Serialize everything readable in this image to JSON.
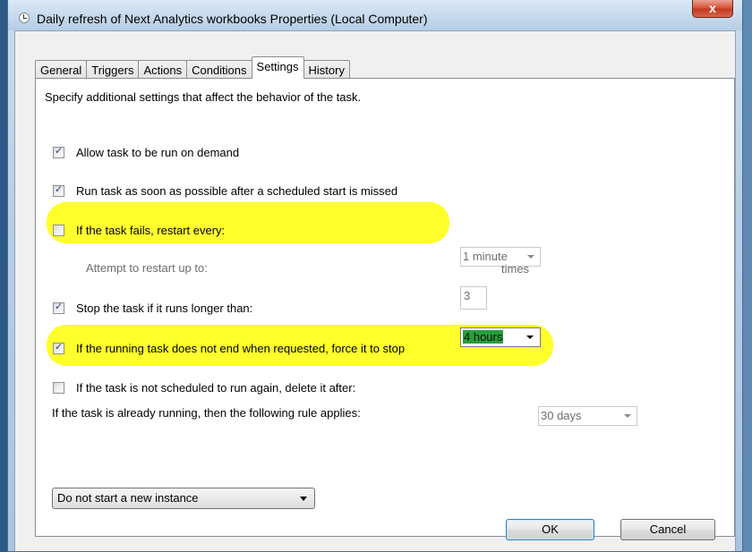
{
  "window": {
    "title": "Daily refresh of  Next Analytics workbooks Properties (Local Computer)",
    "close_label": "x"
  },
  "tabs": [
    {
      "label": "General",
      "active": false
    },
    {
      "label": "Triggers",
      "active": false
    },
    {
      "label": "Actions",
      "active": false
    },
    {
      "label": "Conditions",
      "active": false
    },
    {
      "label": "Settings",
      "active": true
    },
    {
      "label": "History",
      "active": false
    }
  ],
  "settings": {
    "description": "Specify additional settings that affect the behavior of the task.",
    "allow_on_demand": {
      "label": "Allow task to be run on demand",
      "checked": true
    },
    "run_asap": {
      "label": "Run task as soon as possible after a scheduled start is missed",
      "checked": true
    },
    "restart_on_fail": {
      "label": "If the task fails, restart every:",
      "checked": false,
      "interval": "1 minute"
    },
    "restart_attempts": {
      "label": "Attempt to restart up to:",
      "value": "3",
      "unit": "times"
    },
    "stop_if_longer": {
      "label": "Stop the task if it runs longer than:",
      "checked": true,
      "duration": "4 hours"
    },
    "force_stop": {
      "label": "If the running task does not end when requested, force it to stop",
      "checked": true
    },
    "delete_if_not_scheduled": {
      "label": "If the task is not scheduled to run again, delete it after:",
      "checked": false,
      "duration": "30 days"
    },
    "running_rule_label": "If the task is already running, then the following rule applies:",
    "running_rule_value": "Do not start a new instance"
  },
  "buttons": {
    "ok": "OK",
    "cancel": "Cancel"
  },
  "colors": {
    "highlight": "#ffff2b",
    "selection": "#269f3b"
  }
}
